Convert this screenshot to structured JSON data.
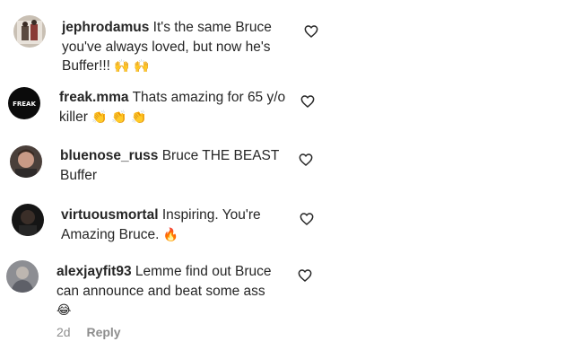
{
  "comments": [
    {
      "username": "jephrodamus",
      "text": "It's the same Bruce",
      "text2": "you've always loved, but now he's",
      "text3": "Buffer!!!",
      "emoji": "🙌 🙌"
    },
    {
      "username": "freak.mma",
      "avatar_label": "FREAK",
      "text": "Thats amazing for 65 y/o",
      "text2": "killer",
      "emoji": "👏 👏 👏"
    },
    {
      "username": "bluenose_russ",
      "text": "Bruce THE BEAST",
      "text2": "Buffer"
    },
    {
      "username": "virtuousmortal",
      "text": "Inspiring. You're",
      "text2": "Amazing Bruce.",
      "emoji": "🔥"
    },
    {
      "username": "alexjayfit93",
      "text": "Lemme find out Bruce",
      "text2": "can announce and beat some ass",
      "emoji": "😂"
    }
  ],
  "meta": {
    "time": "2d",
    "reply_label": "Reply"
  },
  "icons": {
    "like": "heart-outline-icon"
  }
}
